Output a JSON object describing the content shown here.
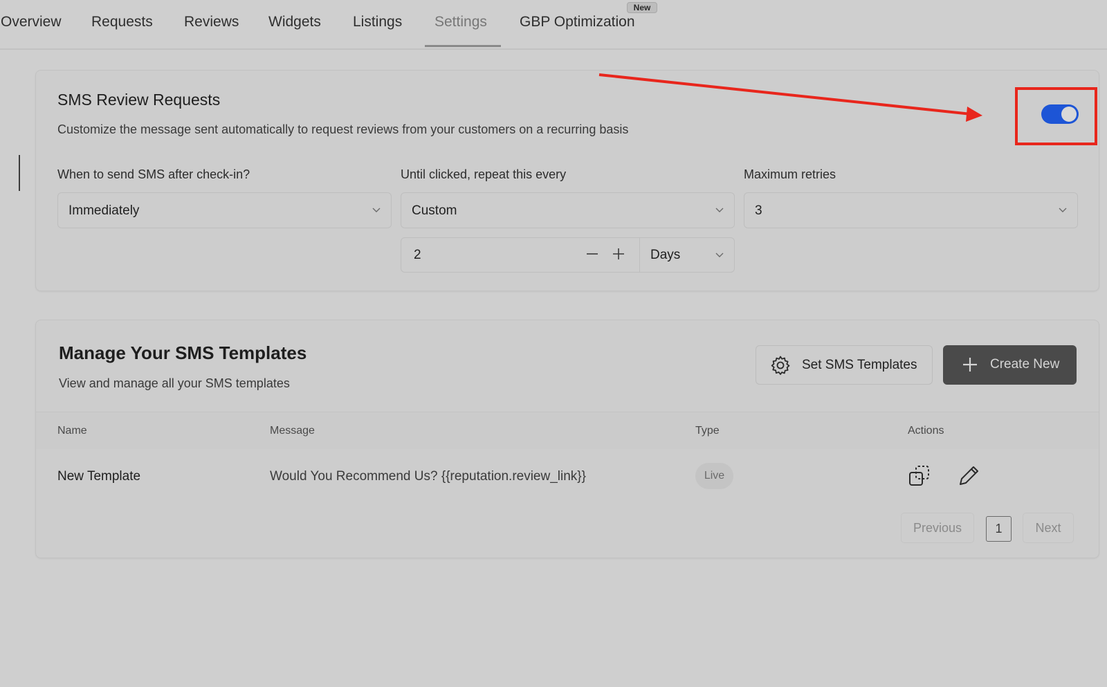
{
  "tabs": {
    "overview": "Overview",
    "requests": "Requests",
    "reviews": "Reviews",
    "widgets": "Widgets",
    "listings": "Listings",
    "settings": "Settings",
    "gbp": "GBP Optimization",
    "gbp_badge": "New",
    "active": "Settings"
  },
  "sms_requests": {
    "title": "SMS Review Requests",
    "description": "Customize the message sent automatically to request reviews from your customers on a recurring basis",
    "enabled": true,
    "when_label": "When to send SMS after check-in?",
    "when_value": "Immediately",
    "repeat_label": "Until clicked, repeat this every",
    "repeat_value": "Custom",
    "repeat_count": "2",
    "repeat_unit": "Days",
    "retries_label": "Maximum retries",
    "retries_value": "3"
  },
  "templates": {
    "title": "Manage Your SMS Templates",
    "description": "View and manage all your SMS templates",
    "set_button": "Set SMS Templates",
    "create_button": "Create New",
    "columns": {
      "name": "Name",
      "message": "Message",
      "type": "Type",
      "actions": "Actions"
    },
    "rows": [
      {
        "name": "New Template",
        "message": "Would You Recommend Us? {{reputation.review_link}}",
        "type": "Live"
      }
    ],
    "pagination": {
      "previous": "Previous",
      "page": "1",
      "next": "Next"
    }
  },
  "colors": {
    "toggle_on": "#1d55d6",
    "annotation": "#e8261c"
  }
}
